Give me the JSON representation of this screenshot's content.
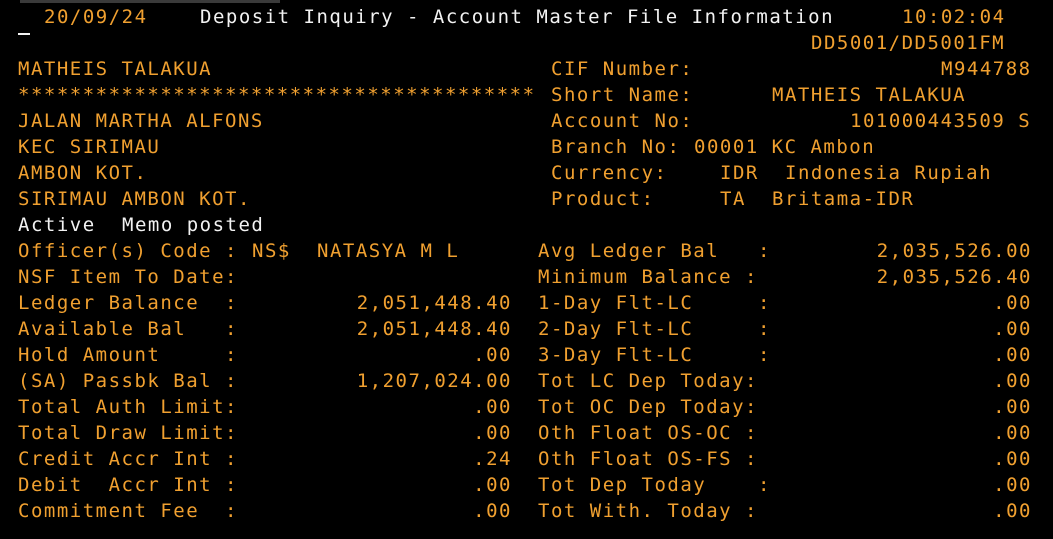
{
  "header": {
    "date": "20/09/24",
    "title": "Deposit Inquiry - Account Master File Information",
    "time": "10:02:04",
    "screen_id": "DD5001/DD5001FM"
  },
  "customer": {
    "name": "MATHEIS TALAKUA",
    "masked_line": "****************************************",
    "address_1": "JALAN MARTHA ALFONS",
    "address_2": "KEC SIRIMAU",
    "address_3": "AMBON KOT.",
    "address_4": "SIRIMAU AMBON KOT."
  },
  "account_info": {
    "cif_label": "CIF Number:",
    "cif_value": "M944788",
    "short_name_label": "Short Name:",
    "short_name_value": "MATHEIS TALAKUA",
    "account_no_label": "Account No:",
    "account_no_value": "101000443509 S",
    "branch_label": "Branch No:",
    "branch_value": "00001 KC Ambon",
    "currency_label": "Currency:",
    "currency_code": "IDR",
    "currency_name": "Indonesia Rupiah",
    "product_label": "Product:",
    "product_code": "TA",
    "product_name": "Britama-IDR"
  },
  "status": {
    "active": "Active",
    "memo": "Memo posted"
  },
  "officer": {
    "label": "Officer(s) Code :",
    "code": "NS$",
    "name": "NATASYA M L"
  },
  "left_fields": [
    {
      "label": "NSF Item To Date:",
      "value": ""
    },
    {
      "label": "Ledger Balance  :",
      "value": "2,051,448.40"
    },
    {
      "label": "Available Bal   :",
      "value": "2,051,448.40"
    },
    {
      "label": "Hold Amount     :",
      "value": ".00"
    },
    {
      "label": "(SA) Passbk Bal :",
      "value": "1,207,024.00"
    },
    {
      "label": "Total Auth Limit:",
      "value": ".00"
    },
    {
      "label": "Total Draw Limit:",
      "value": ".00"
    },
    {
      "label": "Credit Accr Int :",
      "value": ".24"
    },
    {
      "label": "Debit  Accr Int :",
      "value": ".00"
    },
    {
      "label": "Commitment Fee  :",
      "value": ".00"
    }
  ],
  "right_fields": [
    {
      "label": "Avg Ledger Bal   :",
      "value": "2,035,526.00"
    },
    {
      "label": "Minimum Balance :",
      "value": "2,035,526.40"
    },
    {
      "label": "1-Day Flt-LC     :",
      "value": ".00"
    },
    {
      "label": "2-Day Flt-LC     :",
      "value": ".00"
    },
    {
      "label": "3-Day Flt-LC     :",
      "value": ".00"
    },
    {
      "label": "Tot LC Dep Today:",
      "value": ".00"
    },
    {
      "label": "Tot OC Dep Today:",
      "value": ".00"
    },
    {
      "label": "Oth Float OS-OC :",
      "value": ".00"
    },
    {
      "label": "Oth Float OS-FS :",
      "value": ".00"
    },
    {
      "label": "Tot Dep Today    :",
      "value": ".00"
    },
    {
      "label": "Tot With. Today :",
      "value": ".00"
    }
  ],
  "colors": {
    "background": "#000000",
    "field_text": "#f0a030",
    "title_text": "#f2f2f2"
  }
}
